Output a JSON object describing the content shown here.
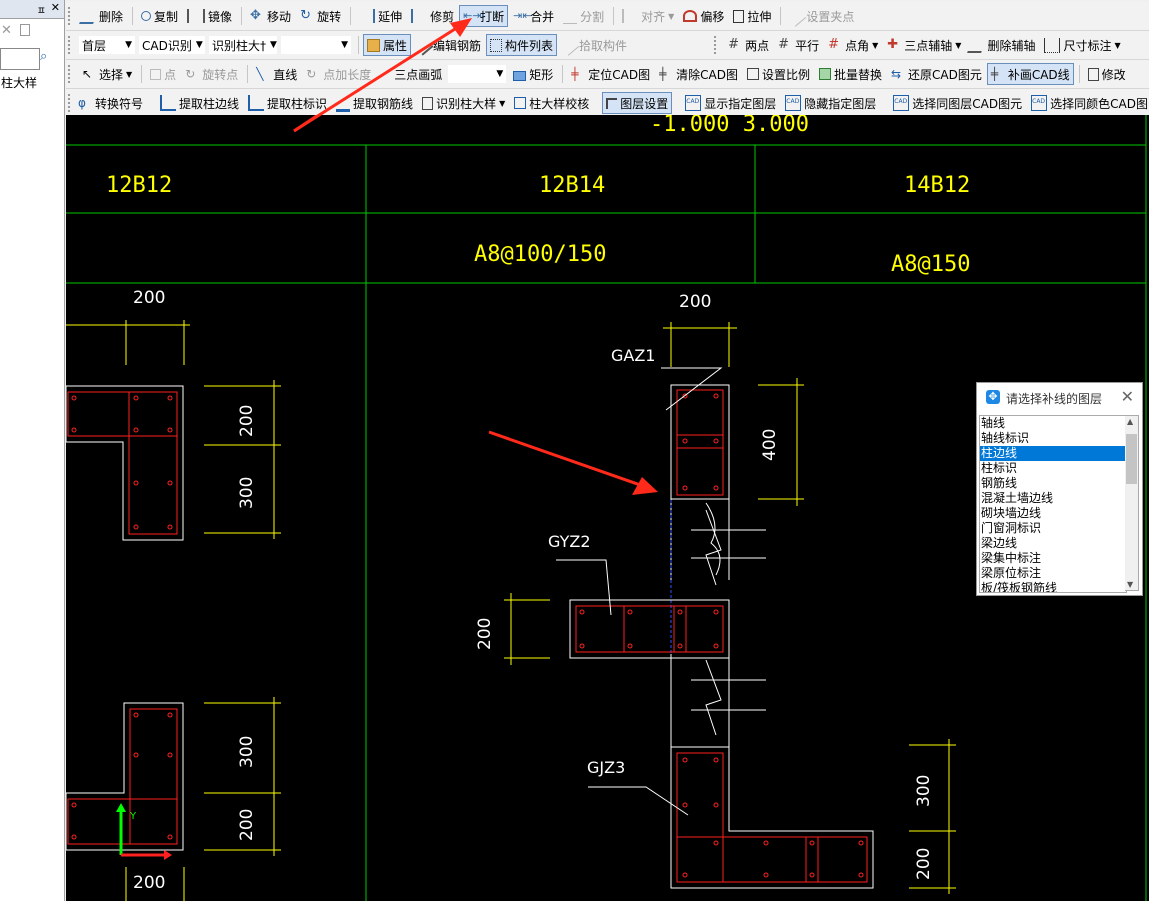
{
  "left_panel": {
    "item": "柱大样"
  },
  "toolbar1": {
    "delete": "删除",
    "copy": "复制",
    "mirror": "镜像",
    "move": "移动",
    "rotate": "旋转",
    "extend": "延伸",
    "trim": "修剪",
    "break": "打断",
    "merge": "合并",
    "split": "分割",
    "align": "对齐",
    "offset": "偏移",
    "stretch": "拉伸",
    "set_grip": "设置夹点"
  },
  "toolbar2": {
    "floor": "首层",
    "cad_recognize": "CAD识别",
    "recognize_column": "识别柱大†",
    "blank_select": "",
    "property": "属性",
    "edit_rebar": "编辑钢筋",
    "component_list": "构件列表",
    "pick_component": "拾取构件",
    "two_points": "两点",
    "parallel": "平行",
    "point_angle": "点角",
    "three_point_axis": "三点辅轴",
    "delete_axis": "删除辅轴",
    "dimension": "尺寸标注"
  },
  "toolbar3": {
    "select": "选择",
    "point": "点",
    "rotate_point": "旋转点",
    "line": "直线",
    "point_length": "点加长度",
    "three_point_arc": "三点画弧",
    "rect": "矩形",
    "locate_cad": "定位CAD图",
    "clear_cad": "清除CAD图",
    "set_scale": "设置比例",
    "batch_replace": "批量替换",
    "restore_cad": "还原CAD图元",
    "supplement_cad": "补画CAD线",
    "modify": "修改"
  },
  "toolbar4": {
    "convert_symbol": "转换符号",
    "extract_edge": "提取柱边线",
    "extract_mark": "提取柱标识",
    "extract_rebar": "提取钢筋线",
    "recognize_detail": "识别柱大样",
    "detail_check": "柱大样校核",
    "layer_setting": "图层设置",
    "show_layer": "显示指定图层",
    "hide_layer": "隐藏指定图层",
    "select_same_layer": "选择同图层CAD图元",
    "select_same_color": "选择同颜色CAD图"
  },
  "drawing": {
    "elevation": "-1.000  3.000",
    "rebar_cells": [
      "12B12",
      "12B14",
      "14B12"
    ],
    "stirrup_cells": [
      "A8@100/150",
      "A8@150"
    ],
    "dims": {
      "d200": "200",
      "d300": "300",
      "d400": "400"
    },
    "labels": {
      "gaz1": "GAZ1",
      "gyz2": "GYZ2",
      "gjz3": "GJZ3"
    },
    "axis_y": "Y"
  },
  "layer_dialog": {
    "title": "请选择补线的图层",
    "items": [
      "轴线",
      "轴线标识",
      "柱边线",
      "柱标识",
      "钢筋线",
      "混凝土墙边线",
      "砌块墙边线",
      "门窗洞标识",
      "梁边线",
      "梁集中标注",
      "梁原位标注",
      "板/筏板钢筋线"
    ],
    "selected_index": 2
  },
  "colors": {
    "cad_bg": "#000000",
    "grid": "#00c800",
    "text": "#ffff00",
    "column": "#ff2020",
    "dim": "#ffffff",
    "arrow": "#ff2a1a"
  }
}
